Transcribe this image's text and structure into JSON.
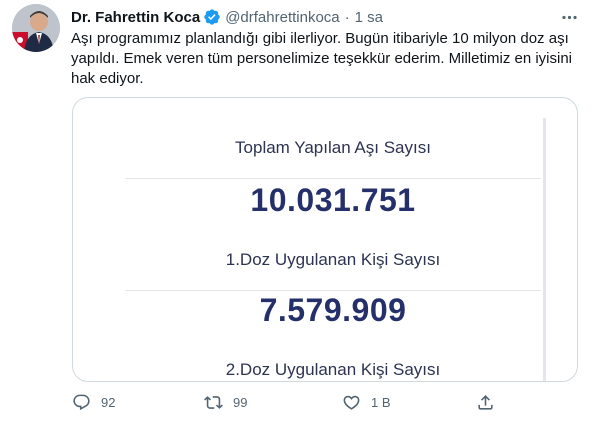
{
  "tweet": {
    "author_name": "Dr. Fahrettin Koca",
    "handle": "@drfahrettinkoca",
    "separator": "·",
    "time": "1 sa",
    "text": "Aşı programımız planlandığı gibi ilerliyor. Bugün itibariyle 10 milyon doz aşı yapıldı. Emek veren tüm personelimize teşekkür ederim. Milletimiz en iyisini hak ediyor."
  },
  "media": {
    "total_label": "Toplam Yapılan Aşı Sayısı",
    "total_value": "10.031.751",
    "dose1_label": "1.Doz Uygulanan Kişi Sayısı",
    "dose1_value": "7.579.909",
    "dose2_label": "2.Doz Uygulanan Kişi Sayısı"
  },
  "actions": {
    "reply_count": "92",
    "retweet_count": "99",
    "like_count": "1 B"
  },
  "icons": {
    "verified": "verified-badge-icon",
    "more": "more-dots-icon",
    "reply": "reply-icon",
    "retweet": "retweet-icon",
    "like": "heart-icon",
    "share": "share-icon"
  },
  "colors": {
    "accent": "#1d9bf0",
    "muted": "#536471",
    "stat_value": "#25306b"
  }
}
